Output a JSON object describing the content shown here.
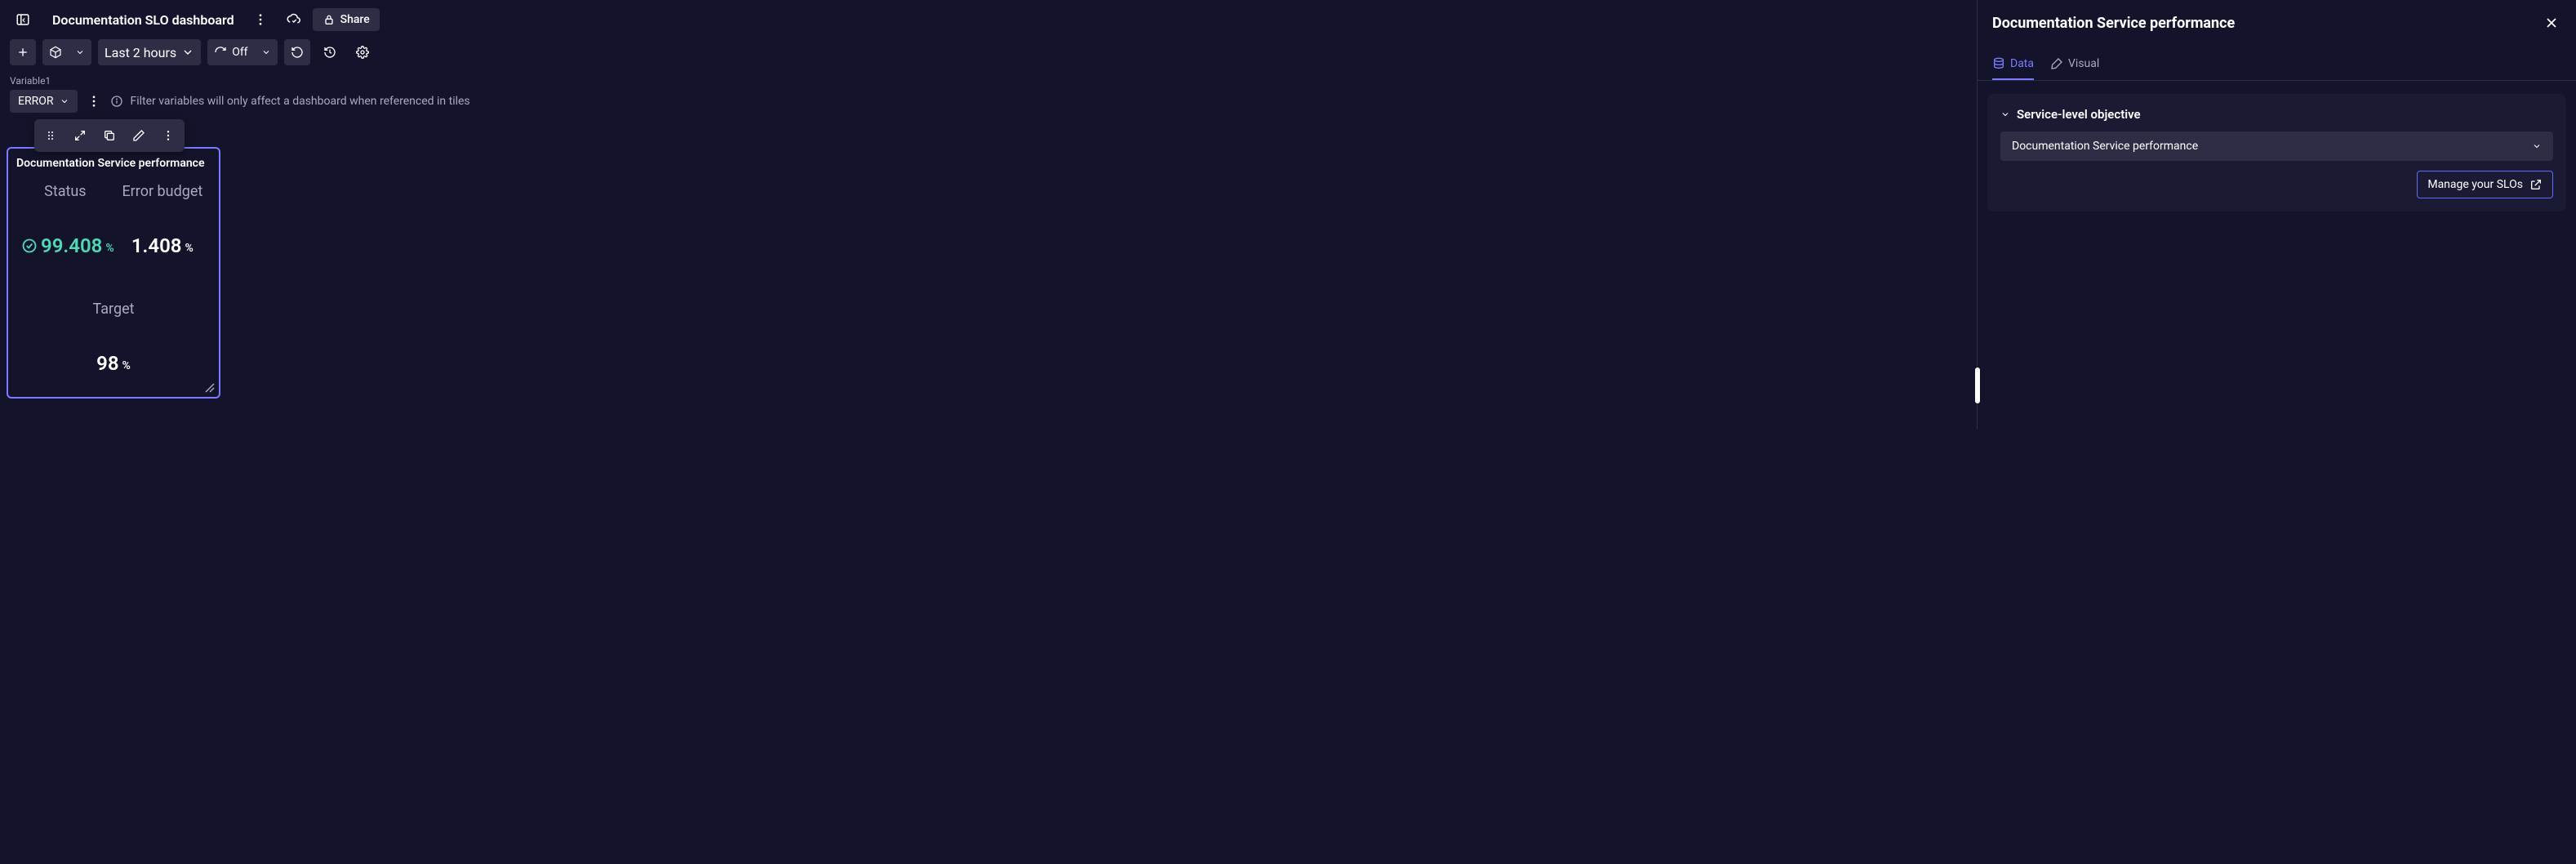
{
  "header": {
    "title": "Documentation SLO dashboard",
    "share_label": "Share"
  },
  "toolbar": {
    "timerange": "Last 2 hours",
    "refresh_label": "Off"
  },
  "variables": {
    "label": "Variable1",
    "value": "ERROR",
    "filter_hint": "Filter variables will only affect a dashboard when referenced in tiles"
  },
  "tile": {
    "title": "Documentation Service performance",
    "status_label": "Status",
    "status_value": "99.408",
    "error_budget_label": "Error budget",
    "error_budget_value": "1.408",
    "target_label": "Target",
    "target_value": "98",
    "pct": "%"
  },
  "right": {
    "title": "Documentation Service performance",
    "tabs": {
      "data": "Data",
      "visual": "Visual"
    },
    "section_title": "Service-level objective",
    "slo_selected": "Documentation Service performance",
    "manage_label": "Manage your SLOs"
  }
}
